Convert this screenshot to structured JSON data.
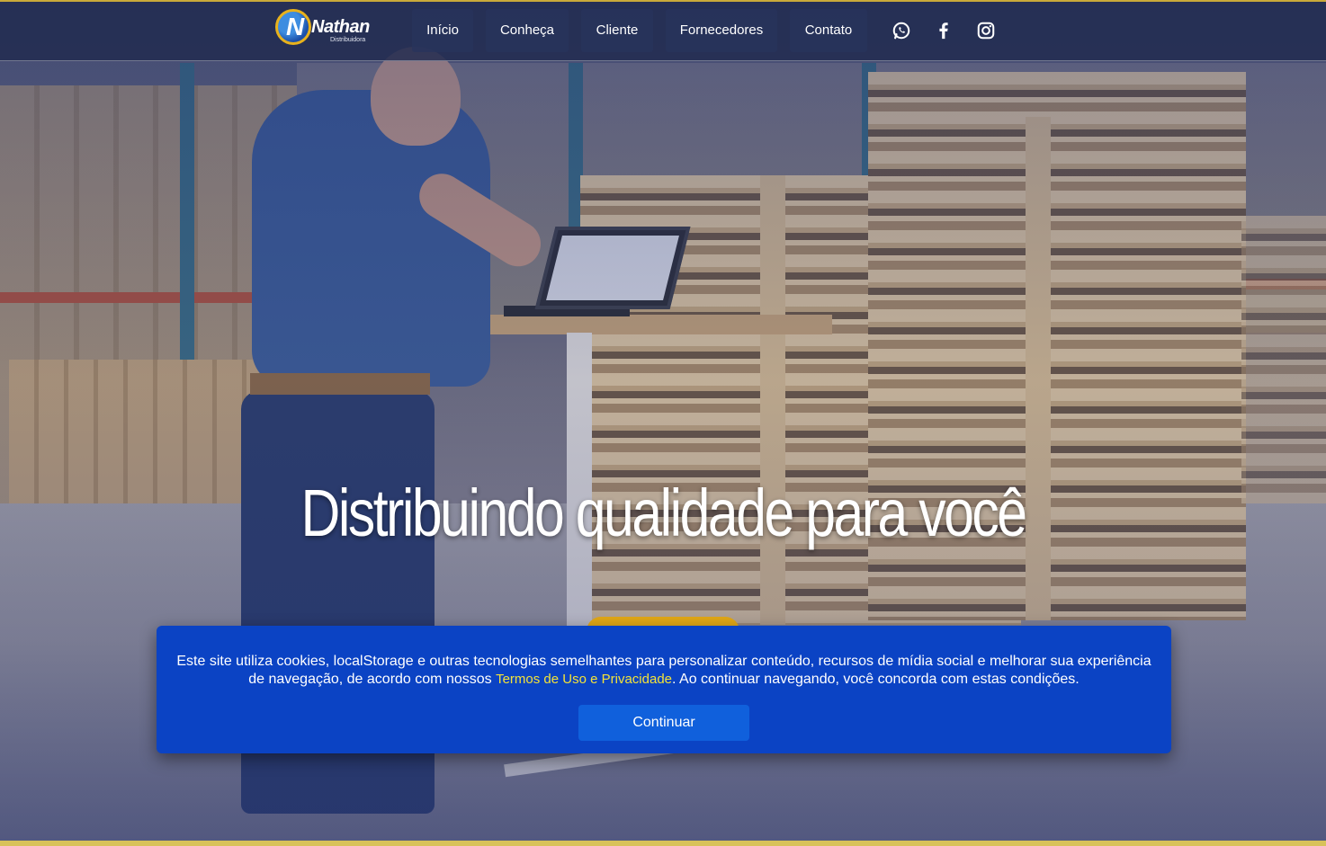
{
  "brand": {
    "logo_initial": "N",
    "name": "Nathan",
    "tagline": "Distribuidora"
  },
  "nav": {
    "items": [
      {
        "label": "Início"
      },
      {
        "label": "Conheça"
      },
      {
        "label": "Cliente"
      },
      {
        "label": "Fornecedores"
      },
      {
        "label": "Contato"
      }
    ],
    "social": [
      "whatsapp-icon",
      "facebook-icon",
      "instagram-icon"
    ]
  },
  "hero": {
    "headline": "Distribuindo qualidade para você"
  },
  "cookie_banner": {
    "text_before": "Este site utiliza cookies, localStorage e outras tecnologias semelhantes para personalizar conteúdo, recursos de mídia social e melhorar sua experiência de navegação, de acordo com nossos ",
    "link_text": "Termos de Uso e Privacidade",
    "text_after": ". Ao continuar navegando, você concorda com estas condições.",
    "button_label": "Continuar"
  },
  "colors": {
    "navbar": "#202a4e",
    "accent": "#c9a93a",
    "cookie_bg": "#0b43c4",
    "cookie_button": "#1060dc",
    "cookie_link": "#f2e23a"
  }
}
